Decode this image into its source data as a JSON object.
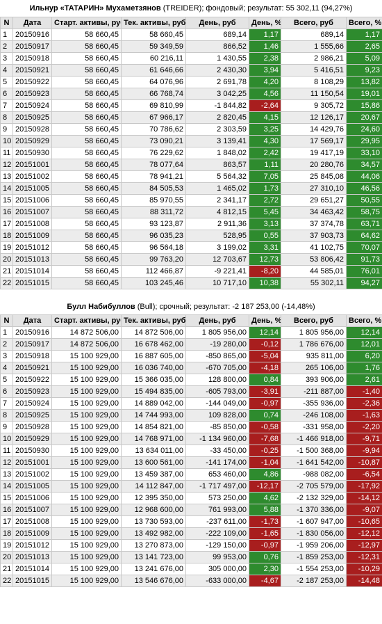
{
  "table1": {
    "title_name": "Ильнур «ТАТАРИН» Мухаметзянов",
    "title_rest": " (TREIDER); фондовый; результат: 55 302,11 (94,27%)",
    "headers": [
      "N",
      "Дата",
      "Старт. активы, руб",
      "Тек. активы, руб",
      "День, руб",
      "День, %",
      "Всего, руб",
      "Всего, %"
    ],
    "rows": [
      [
        "1",
        "20150916",
        "58 660,45",
        "58 660,45",
        "689,14",
        "1,17",
        "689,14",
        "1,17"
      ],
      [
        "2",
        "20150917",
        "58 660,45",
        "59 349,59",
        "866,52",
        "1,46",
        "1 555,66",
        "2,65"
      ],
      [
        "3",
        "20150918",
        "58 660,45",
        "60 216,11",
        "1 430,55",
        "2,38",
        "2 986,21",
        "5,09"
      ],
      [
        "4",
        "20150921",
        "58 660,45",
        "61 646,66",
        "2 430,30",
        "3,94",
        "5 416,51",
        "9,23"
      ],
      [
        "5",
        "20150922",
        "58 660,45",
        "64 076,96",
        "2 691,78",
        "4,20",
        "8 108,29",
        "13,82"
      ],
      [
        "6",
        "20150923",
        "58 660,45",
        "66 768,74",
        "3 042,25",
        "4,56",
        "11 150,54",
        "19,01"
      ],
      [
        "7",
        "20150924",
        "58 660,45",
        "69 810,99",
        "-1 844,82",
        "-2,64",
        "9 305,72",
        "15,86"
      ],
      [
        "8",
        "20150925",
        "58 660,45",
        "67 966,17",
        "2 820,45",
        "4,15",
        "12 126,17",
        "20,67"
      ],
      [
        "9",
        "20150928",
        "58 660,45",
        "70 786,62",
        "2 303,59",
        "3,25",
        "14 429,76",
        "24,60"
      ],
      [
        "10",
        "20150929",
        "58 660,45",
        "73 090,21",
        "3 139,41",
        "4,30",
        "17 569,17",
        "29,95"
      ],
      [
        "11",
        "20150930",
        "58 660,45",
        "76 229,62",
        "1 848,02",
        "2,42",
        "19 417,19",
        "33,10"
      ],
      [
        "12",
        "20151001",
        "58 660,45",
        "78 077,64",
        "863,57",
        "1,11",
        "20 280,76",
        "34,57"
      ],
      [
        "13",
        "20151002",
        "58 660,45",
        "78 941,21",
        "5 564,32",
        "7,05",
        "25 845,08",
        "44,06"
      ],
      [
        "14",
        "20151005",
        "58 660,45",
        "84 505,53",
        "1 465,02",
        "1,73",
        "27 310,10",
        "46,56"
      ],
      [
        "15",
        "20151006",
        "58 660,45",
        "85 970,55",
        "2 341,17",
        "2,72",
        "29 651,27",
        "50,55"
      ],
      [
        "16",
        "20151007",
        "58 660,45",
        "88 311,72",
        "4 812,15",
        "5,45",
        "34 463,42",
        "58,75"
      ],
      [
        "17",
        "20151008",
        "58 660,45",
        "93 123,87",
        "2 911,36",
        "3,13",
        "37 374,78",
        "63,71"
      ],
      [
        "18",
        "20151009",
        "58 660,45",
        "96 035,23",
        "528,95",
        "0,55",
        "37 903,73",
        "64,62"
      ],
      [
        "19",
        "20151012",
        "58 660,45",
        "96 564,18",
        "3 199,02",
        "3,31",
        "41 102,75",
        "70,07"
      ],
      [
        "20",
        "20151013",
        "58 660,45",
        "99 763,20",
        "12 703,67",
        "12,73",
        "53 806,42",
        "91,73"
      ],
      [
        "21",
        "20151014",
        "58 660,45",
        "112 466,87",
        "-9 221,41",
        "-8,20",
        "44 585,01",
        "76,01"
      ],
      [
        "22",
        "20151015",
        "58 660,45",
        "103 245,46",
        "10 717,10",
        "10,38",
        "55 302,11",
        "94,27"
      ]
    ]
  },
  "table2": {
    "title_name": "Булл Набибуллов",
    "title_rest": " (Bull); срочный; результат: -2 187 253,00 (-14,48%)",
    "headers": [
      "N",
      "Дата",
      "Старт. активы, руб",
      "Тек. активы, руб",
      "День, руб",
      "День, %",
      "Всего, руб",
      "Всего, %"
    ],
    "rows": [
      [
        "1",
        "20150916",
        "14 872 506,00",
        "14 872 506,00",
        "1 805 956,00",
        "12,14",
        "1 805 956,00",
        "12,14"
      ],
      [
        "2",
        "20150917",
        "14 872 506,00",
        "16 678 462,00",
        "-19 280,00",
        "-0,12",
        "1 786 676,00",
        "12,01"
      ],
      [
        "3",
        "20150918",
        "15 100 929,00",
        "16 887 605,00",
        "-850 865,00",
        "-5,04",
        "935 811,00",
        "6,20"
      ],
      [
        "4",
        "20150921",
        "15 100 929,00",
        "16 036 740,00",
        "-670 705,00",
        "-4,18",
        "265 106,00",
        "1,76"
      ],
      [
        "5",
        "20150922",
        "15 100 929,00",
        "15 366 035,00",
        "128 800,00",
        "0,84",
        "393 906,00",
        "2,61"
      ],
      [
        "6",
        "20150923",
        "15 100 929,00",
        "15 494 835,00",
        "-605 793,00",
        "-3,91",
        "-211 887,00",
        "-1,40"
      ],
      [
        "7",
        "20150924",
        "15 100 929,00",
        "14 889 042,00",
        "-144 049,00",
        "-0,97",
        "-355 936,00",
        "-2,36"
      ],
      [
        "8",
        "20150925",
        "15 100 929,00",
        "14 744 993,00",
        "109 828,00",
        "0,74",
        "-246 108,00",
        "-1,63"
      ],
      [
        "9",
        "20150928",
        "15 100 929,00",
        "14 854 821,00",
        "-85 850,00",
        "-0,58",
        "-331 958,00",
        "-2,20"
      ],
      [
        "10",
        "20150929",
        "15 100 929,00",
        "14 768 971,00",
        "-1 134 960,00",
        "-7,68",
        "-1 466 918,00",
        "-9,71"
      ],
      [
        "11",
        "20150930",
        "15 100 929,00",
        "13 634 011,00",
        "-33 450,00",
        "-0,25",
        "-1 500 368,00",
        "-9,94"
      ],
      [
        "12",
        "20151001",
        "15 100 929,00",
        "13 600 561,00",
        "-141 174,00",
        "-1,04",
        "-1 641 542,00",
        "-10,87"
      ],
      [
        "13",
        "20151002",
        "15 100 929,00",
        "13 459 387,00",
        "653 460,00",
        "4,86",
        "-988 082,00",
        "-6,54"
      ],
      [
        "14",
        "20151005",
        "15 100 929,00",
        "14 112 847,00",
        "-1 717 497,00",
        "-12,17",
        "-2 705 579,00",
        "-17,92"
      ],
      [
        "15",
        "20151006",
        "15 100 929,00",
        "12 395 350,00",
        "573 250,00",
        "4,62",
        "-2 132 329,00",
        "-14,12"
      ],
      [
        "16",
        "20151007",
        "15 100 929,00",
        "12 968 600,00",
        "761 993,00",
        "5,88",
        "-1 370 336,00",
        "-9,07"
      ],
      [
        "17",
        "20151008",
        "15 100 929,00",
        "13 730 593,00",
        "-237 611,00",
        "-1,73",
        "-1 607 947,00",
        "-10,65"
      ],
      [
        "18",
        "20151009",
        "15 100 929,00",
        "13 492 982,00",
        "-222 109,00",
        "-1,65",
        "-1 830 056,00",
        "-12,12"
      ],
      [
        "19",
        "20151012",
        "15 100 929,00",
        "13 270 873,00",
        "-129 150,00",
        "-0,97",
        "-1 959 206,00",
        "-12,97"
      ],
      [
        "20",
        "20151013",
        "15 100 929,00",
        "13 141 723,00",
        "99 953,00",
        "0,76",
        "-1 859 253,00",
        "-12,31"
      ],
      [
        "21",
        "20151014",
        "15 100 929,00",
        "13 241 676,00",
        "305 000,00",
        "2,30",
        "-1 554 253,00",
        "-10,29"
      ],
      [
        "22",
        "20151015",
        "15 100 929,00",
        "13 546 676,00",
        "-633 000,00",
        "-4,67",
        "-2 187 253,00",
        "-14,48"
      ]
    ]
  },
  "colors": {
    "positive": "#2e8b2e",
    "negative": "#a81e1e",
    "header_bg": "#e4e4e4",
    "alt_row_bg": "#ececec"
  }
}
